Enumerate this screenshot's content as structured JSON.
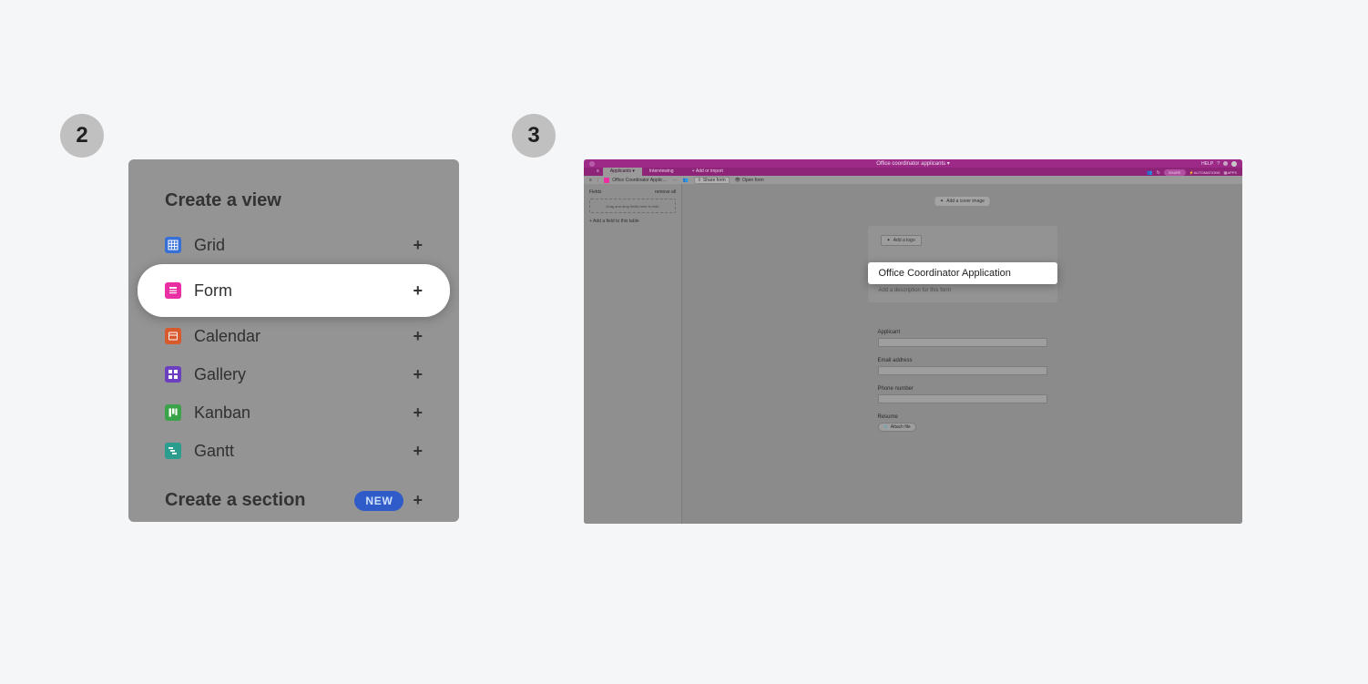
{
  "steps": {
    "two": "2",
    "three": "3"
  },
  "panel2": {
    "heading": "Create a view",
    "views": [
      {
        "label": "Grid",
        "icon": "grid-icon",
        "highlight": false
      },
      {
        "label": "Form",
        "icon": "form-icon",
        "highlight": true
      },
      {
        "label": "Calendar",
        "icon": "calendar-icon",
        "highlight": false
      },
      {
        "label": "Gallery",
        "icon": "gallery-icon",
        "highlight": false
      },
      {
        "label": "Kanban",
        "icon": "kanban-icon",
        "highlight": false
      },
      {
        "label": "Gantt",
        "icon": "gantt-icon",
        "highlight": false
      }
    ],
    "section_label": "Create a section",
    "new_badge": "NEW",
    "plus": "+"
  },
  "panel3": {
    "appbar": {
      "title": "Office coordinator applicants",
      "help": "HELP",
      "icons": [
        "help-icon",
        "notification-icon",
        "avatar-icon"
      ]
    },
    "tabs": {
      "items": [
        {
          "label": "Applicants",
          "active": true
        },
        {
          "label": "Interviewing",
          "active": false
        }
      ],
      "add_or_import": "Add or import"
    },
    "right_badges": {
      "history": "history-icon",
      "share_pill": "SHARE",
      "automations": "AUTOMATIONS",
      "apps": "APPS"
    },
    "toolbar": {
      "view_name": "Office Coordinator Applic…",
      "dots": "⋯",
      "users": "users-icon",
      "share_form": "Share form",
      "open_form": "Open form"
    },
    "fields_panel": {
      "header": "Fields",
      "remove_all": "remove all",
      "dropzone_hint": "Drag and drop fields here to hide",
      "add_field": "+  Add a field to this table"
    },
    "canvas": {
      "add_cover": "Add a cover image",
      "add_logo": "Add a logo",
      "form_title": "Office Coordinator Application",
      "form_desc_placeholder": "Add a description for this form",
      "fields": [
        {
          "label": "Applicant",
          "type": "text"
        },
        {
          "label": "Email address",
          "type": "text"
        },
        {
          "label": "Phone number",
          "type": "text"
        },
        {
          "label": "Resume",
          "type": "attach"
        }
      ],
      "attach_label": "Attach file"
    }
  }
}
